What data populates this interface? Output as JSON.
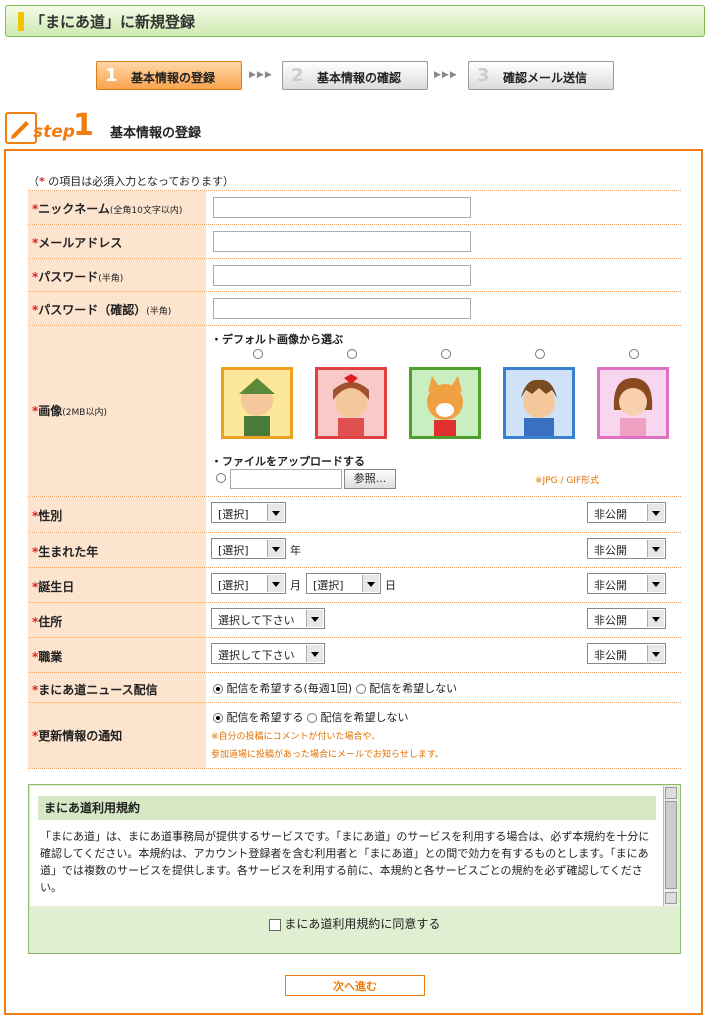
{
  "header": {
    "title": "「まにあ道」に新規登録"
  },
  "steps": [
    {
      "num": "1",
      "label": "基本情報の登録"
    },
    {
      "num": "2",
      "label": "基本情報の確認"
    },
    {
      "num": "3",
      "label": "確認メール送信"
    }
  ],
  "step_arrows": "▶▶▶",
  "step_logo": {
    "word": "step",
    "num": "1"
  },
  "section_title": "基本情報の登録",
  "required_note": {
    "open": "（",
    "star": "*",
    "text": " の項目は必須入力となっております）"
  },
  "fields": {
    "nickname": {
      "label": "ニックネーム",
      "sub": "(全角10文字以内)"
    },
    "email": {
      "label": "メールアドレス"
    },
    "password": {
      "label": "パスワード",
      "sub": "(半角)"
    },
    "password_confirm": {
      "label": "パスワード（確認）",
      "sub": "(半角)"
    },
    "image": {
      "label": "画像",
      "sub": "(2MB以内)",
      "default_heading": "・デフォルト画像から選ぶ",
      "upload_heading": "・ファイルをアップロードする",
      "browse": "参照...",
      "format_note": "※JPG / GIF形式"
    },
    "gender": {
      "label": "性別",
      "value": "[選択]",
      "visibility": "非公開"
    },
    "birth_year": {
      "label": "生まれた年",
      "value": "[選択]",
      "unit": "年",
      "visibility": "非公開"
    },
    "birthday": {
      "label": "誕生日",
      "month": "[選択]",
      "month_unit": "月",
      "day": "[選択]",
      "day_unit": "日",
      "visibility": "非公開"
    },
    "address": {
      "label": "住所",
      "value": "選択して下さい",
      "visibility": "非公開"
    },
    "job": {
      "label": "職業",
      "value": "選択して下さい",
      "visibility": "非公開"
    },
    "newsletter": {
      "label": "まにあ道ニュース配信",
      "opt_yes": "配信を希望する(毎週1回)",
      "opt_no": "配信を希望しない"
    },
    "update_notice": {
      "label": "更新情報の通知",
      "opt_yes": "配信を希望する",
      "opt_no": "配信を希望しない",
      "note1": "※自分の投稿にコメントが付いた場合や、",
      "note2": "参加道場に投稿があった場合にメールでお知らせします。"
    }
  },
  "terms": {
    "title": "まにあ道利用規約",
    "body": "「まにあ道」は、まにあ道事務局が提供するサービスです。「まにあ道」のサービスを利用する場合は、必ず本規約を十分に確認してください。本規約は、アカウント登録者を含む利用者と「まにあ道」との間で効力を有するものとします。「まにあ道」では複数のサービスを提供します。各サービスを利用する前に、本規約と各サービスごとの規約を必ず確認してください。",
    "agree": "まにあ道利用規約に同意する"
  },
  "next_button": "次へ進む",
  "colors": {
    "accent": "#f07d10",
    "label_bg": "#fde4cf",
    "header_green": "#cfe9b0"
  }
}
